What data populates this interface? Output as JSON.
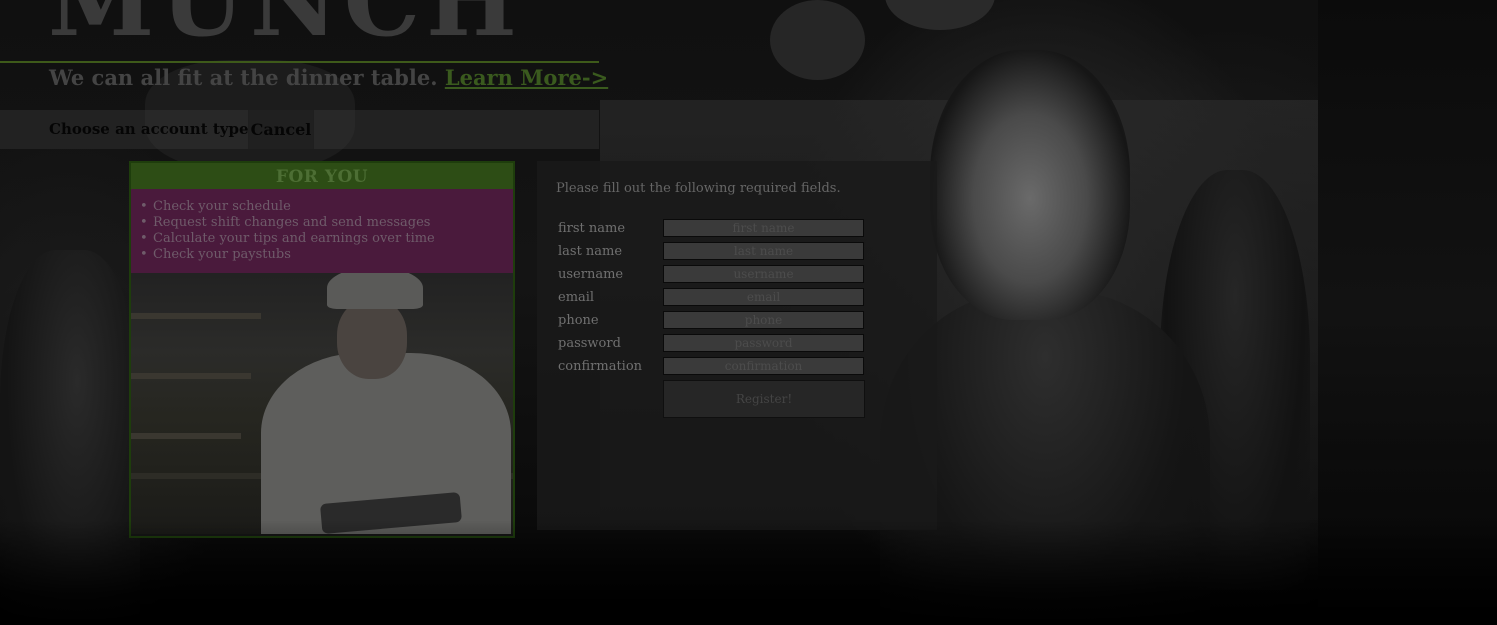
{
  "logo": {
    "text": "MUNCH"
  },
  "tagline": {
    "text": "We can all fit at the dinner table.",
    "link_label": "Learn More->"
  },
  "account_bar": {
    "label": "Choose an account type:",
    "cancel_label": "Cancel"
  },
  "for_you_card": {
    "title": "FOR YOU",
    "items": [
      "Check your schedule",
      "Request shift changes and send messages",
      "Calculate your tips and earnings over time",
      "Check your paystubs"
    ]
  },
  "registration": {
    "instructions": "Please fill out the following required fields.",
    "fields": [
      {
        "label": "first name",
        "placeholder": "first name"
      },
      {
        "label": "last name",
        "placeholder": "last name"
      },
      {
        "label": "username",
        "placeholder": "username"
      },
      {
        "label": "email",
        "placeholder": "email"
      },
      {
        "label": "phone",
        "placeholder": "phone"
      },
      {
        "label": "password",
        "placeholder": "password"
      },
      {
        "label": "confirmation",
        "placeholder": "confirmation"
      }
    ],
    "submit_label": "Register!"
  },
  "colors": {
    "accent_green": "#2d4d15",
    "link_green": "#3a5a1e",
    "card_purple": "#4a1a3c"
  }
}
